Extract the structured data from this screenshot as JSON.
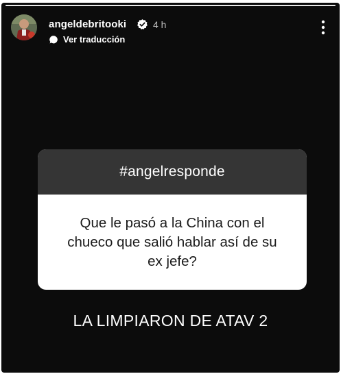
{
  "story": {
    "progress": 1.0,
    "user": {
      "username": "angeldebritooki",
      "timestamp": "4 h",
      "verified": true,
      "avatar_icon": "profile-photo"
    },
    "translate_label": "Ver traducción",
    "question": {
      "title": "#angelresponde",
      "text": "Que le pasó a la China con el chueco que salió hablar así de su ex jefe?"
    },
    "answer": "LA LIMPIARON DE ATAV 2"
  },
  "colors": {
    "background": "#0c0c0c",
    "card_header": "#353535",
    "card_body": "#ffffff",
    "verified_badge": "#ffffff"
  }
}
